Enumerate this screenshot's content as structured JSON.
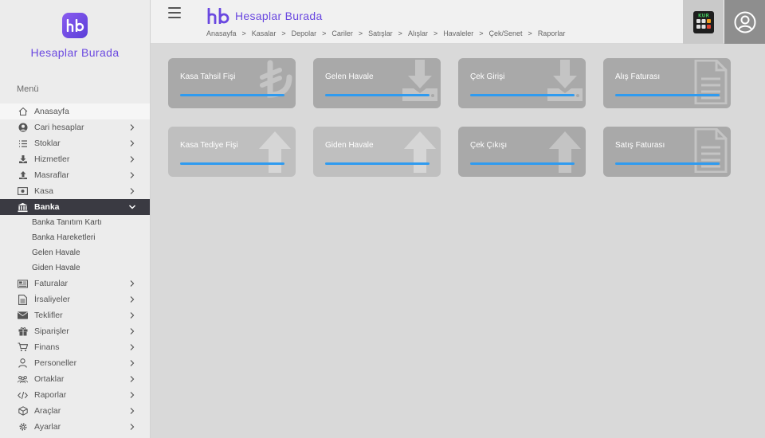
{
  "brand": {
    "name": "Hesaplar Burada",
    "logo_text": "hb"
  },
  "sidebar": {
    "menu_title": "Menü",
    "items": [
      {
        "label": "Anasayfa",
        "icon": "home-icon",
        "chevron": false
      },
      {
        "label": "Cari hesaplar",
        "icon": "user-circle-icon",
        "chevron": true
      },
      {
        "label": "Stoklar",
        "icon": "list-icon",
        "chevron": true
      },
      {
        "label": "Hizmetler",
        "icon": "download-tray-icon",
        "chevron": true
      },
      {
        "label": "Masraflar",
        "icon": "upload-tray-icon",
        "chevron": true
      },
      {
        "label": "Kasa",
        "icon": "money-icon",
        "chevron": true
      },
      {
        "label": "Banka",
        "icon": "bank-icon",
        "chevron": true
      },
      {
        "label": "Faturalar",
        "icon": "newspaper-icon",
        "chevron": true
      },
      {
        "label": "İrsaliyeler",
        "icon": "document-icon",
        "chevron": true
      },
      {
        "label": "Teklifler",
        "icon": "envelope-icon",
        "chevron": true
      },
      {
        "label": "Siparişler",
        "icon": "gift-icon",
        "chevron": true
      },
      {
        "label": "Finans",
        "icon": "cart-icon",
        "chevron": true
      },
      {
        "label": "Personeller",
        "icon": "person-icon",
        "chevron": true
      },
      {
        "label": "Ortaklar",
        "icon": "partners-icon",
        "chevron": true
      },
      {
        "label": "Raporlar",
        "icon": "code-icon",
        "chevron": true
      },
      {
        "label": "Araçlar",
        "icon": "cube-icon",
        "chevron": true
      },
      {
        "label": "Ayarlar",
        "icon": "gear-icon",
        "chevron": true
      }
    ],
    "banka_sub": [
      "Banka Tanıtım Kartı",
      "Banka Hareketleri",
      "Gelen Havale",
      "Giden Havale"
    ]
  },
  "breadcrumb": [
    "Anasayfa",
    "Kasalar",
    "Depolar",
    "Cariler",
    "Satışlar",
    "Alışlar",
    "Havaleler",
    "Çek/Senet",
    "Raporlar"
  ],
  "topbar": {
    "kur_label": "KUR"
  },
  "cards": [
    {
      "label": "Kasa Tahsil Fişi",
      "icon": "lira-icon"
    },
    {
      "label": "Gelen Havale",
      "icon": "download-tray-icon"
    },
    {
      "label": "Çek Girişi",
      "icon": "download-tray-icon"
    },
    {
      "label": "Alış Faturası",
      "icon": "document-icon"
    },
    {
      "label": "Kasa Tediye Fişi",
      "icon": "arrow-up-icon"
    },
    {
      "label": "Giden Havale",
      "icon": "arrow-up-icon"
    },
    {
      "label": "Çek Çıkışı",
      "icon": "arrow-up-icon"
    },
    {
      "label": "Satış Faturası",
      "icon": "document-icon"
    }
  ],
  "colors": {
    "brand": "#6a48e0",
    "accent_bar": "#2f9bf0",
    "active_menu": "#3a3a42"
  }
}
